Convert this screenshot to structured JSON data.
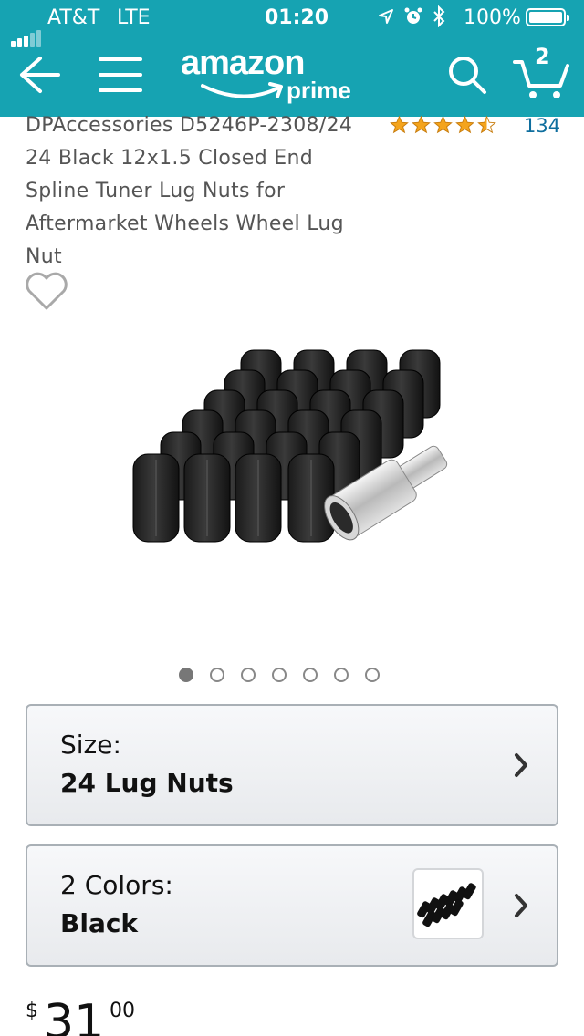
{
  "status_bar": {
    "carrier": "AT&T",
    "network": "LTE",
    "time": "01:20",
    "battery": "100%"
  },
  "header": {
    "logo_text": "amazon",
    "logo_sub": "prime",
    "cart_count": "2",
    "colors": {
      "bar": "#16a3b2",
      "logo_accent": "#ff9900"
    }
  },
  "product": {
    "title": "DPAccessories D5246P-2308/24 24 Black 12x1.5 Closed End Spline Tuner Lug Nuts for Aftermarket Wheels Wheel Lug Nut",
    "rating_stars": 4.5,
    "review_count": "134",
    "image_icon": "lug-nuts-product-photo",
    "image_count": 7,
    "image_active_index": 0
  },
  "size_selector": {
    "label": "Size:",
    "value": "24 Lug Nuts"
  },
  "color_selector": {
    "label": "2 Colors:",
    "value": "Black"
  },
  "price": {
    "currency": "$",
    "whole": "31",
    "fraction": "00"
  }
}
